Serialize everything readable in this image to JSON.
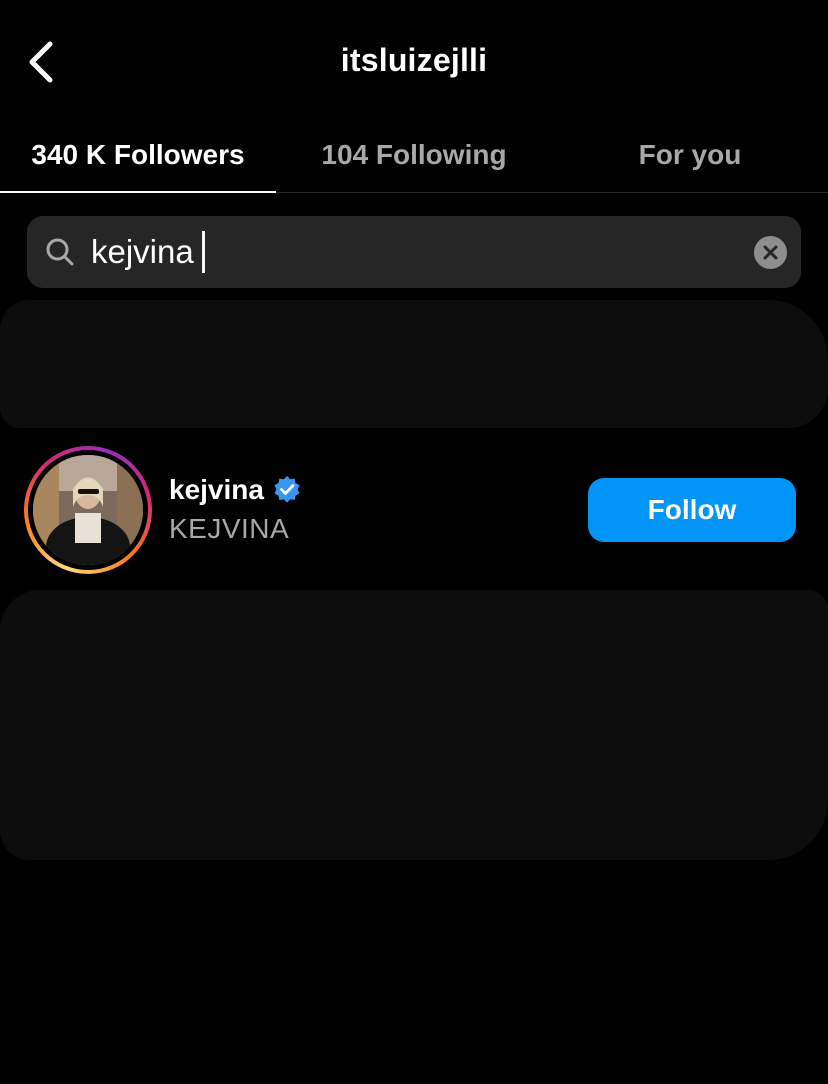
{
  "header": {
    "title": "itsluizejlli",
    "back_icon": "chevron-left-icon"
  },
  "tabs": [
    {
      "label": "340 K Followers",
      "active": true
    },
    {
      "label": "104 Following",
      "active": false
    },
    {
      "label": "For you",
      "active": false
    }
  ],
  "search": {
    "value": "kejvina",
    "icon": "search-icon",
    "clear_icon": "clear-icon"
  },
  "results": [
    {
      "username": "kejvina",
      "verified": true,
      "full_name": "KEJVINA",
      "button_label": "Follow"
    }
  ],
  "colors": {
    "background": "#000000",
    "accent": "#0095f6",
    "verified": "#3897f0",
    "secondary_text": "#a8a8a8",
    "search_bg": "#262626"
  }
}
